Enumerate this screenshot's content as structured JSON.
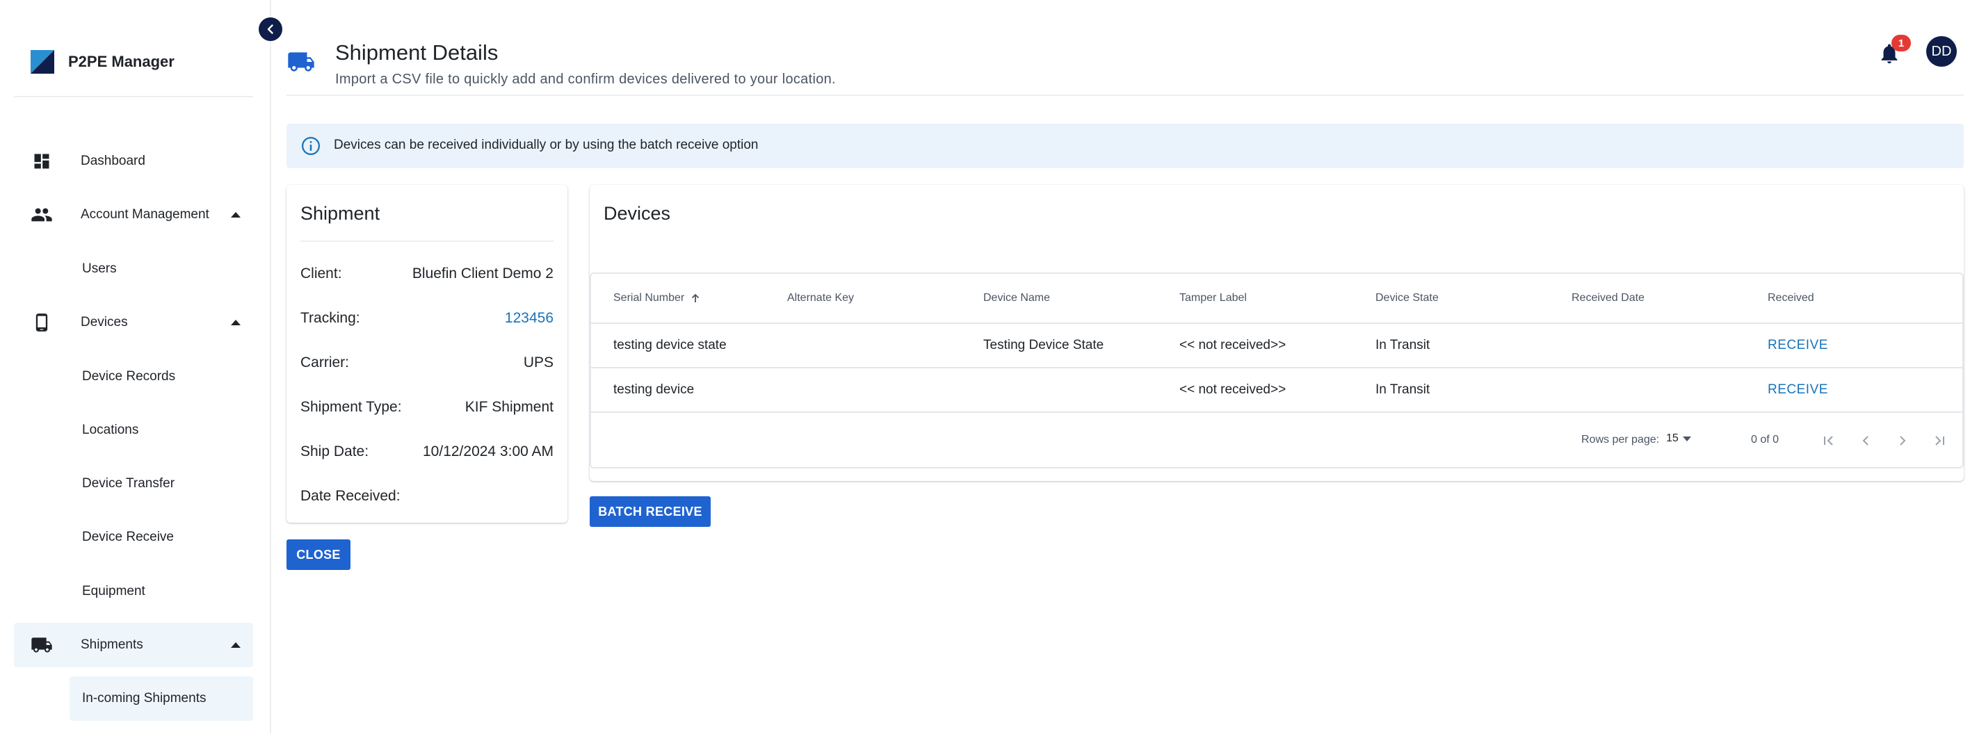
{
  "brand": {
    "name": "P2PE Manager"
  },
  "sidebar": {
    "items": [
      {
        "label": "Dashboard",
        "icon": "dashboard-icon"
      },
      {
        "label": "Account Management",
        "icon": "people-icon",
        "expanded": true
      },
      {
        "label": "Users"
      },
      {
        "label": "Devices",
        "icon": "phone-icon",
        "expanded": true
      },
      {
        "label": "Device Records"
      },
      {
        "label": "Locations"
      },
      {
        "label": "Device Transfer"
      },
      {
        "label": "Device Receive"
      },
      {
        "label": "Equipment"
      },
      {
        "label": "Shipments",
        "icon": "truck-icon",
        "expanded": true,
        "active": true
      },
      {
        "label": "In-coming Shipments",
        "active": true
      }
    ]
  },
  "header": {
    "title": "Shipment Details",
    "subtitle": "Import a CSV file to quickly add and confirm devices delivered to your location.",
    "notification_count": "1",
    "avatar_initials": "DD"
  },
  "info_banner": {
    "text": "Devices can be received individually or by using the batch receive option"
  },
  "shipment": {
    "title": "Shipment",
    "fields": [
      {
        "label": "Client:",
        "value": "Bluefin Client Demo 2"
      },
      {
        "label": "Tracking:",
        "value": "123456"
      },
      {
        "label": "Carrier:",
        "value": "UPS"
      },
      {
        "label": "Shipment Type:",
        "value": "KIF Shipment"
      },
      {
        "label": "Ship Date:",
        "value": "10/12/2024 3:00 AM"
      },
      {
        "label": "Date Received:",
        "value": ""
      }
    ]
  },
  "devices": {
    "title": "Devices",
    "columns": [
      "Serial Number",
      "Alternate Key",
      "Device Name",
      "Tamper Label",
      "Device State",
      "Received Date",
      "Received"
    ],
    "rows": [
      {
        "serial": "testing device state",
        "alt_key": "",
        "name": "Testing Device State",
        "tamper": "<< not received>>",
        "state": "In Transit",
        "received_date": "",
        "action": "RECEIVE"
      },
      {
        "serial": "testing device",
        "alt_key": "",
        "name": "",
        "tamper": "<< not received>>",
        "state": "In Transit",
        "received_date": "",
        "action": "RECEIVE"
      }
    ],
    "pager": {
      "rows_per_page_label": "Rows per page:",
      "rows_per_page": "15",
      "range": "0 of 0"
    }
  },
  "buttons": {
    "batch_receive": "BATCH RECEIVE",
    "close": "CLOSE"
  },
  "colors": {
    "primary": "#1f63d1",
    "link": "#1a73b8",
    "navy": "#0f1d4a",
    "badge": "#e53935",
    "banner": "#eaf3fb"
  }
}
